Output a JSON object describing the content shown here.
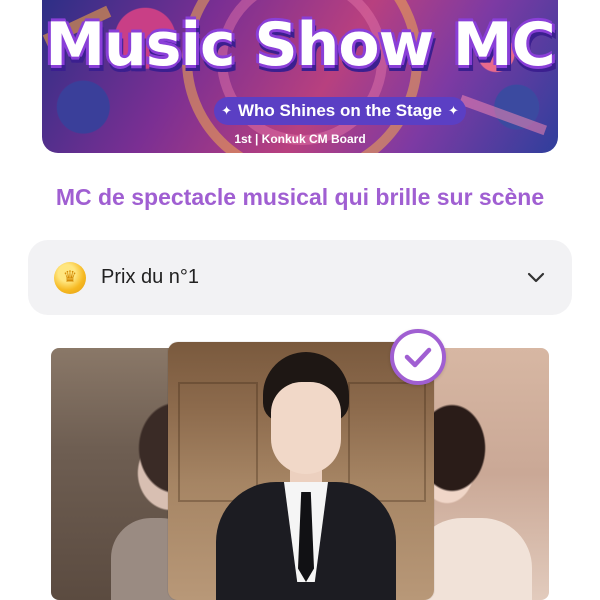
{
  "banner": {
    "title": "Music Show MC",
    "subtitle": "Who Shines on the Stage",
    "caption": "1st | Konkuk CM Board",
    "colors": {
      "title_outline": "#8a3fd8",
      "pill": "#5b3fc4"
    }
  },
  "headline": "MC de spectacle musical qui brille sur scène",
  "prize_dropdown": {
    "label": "Prix du n°1",
    "icon": "gold-crown-coin-icon",
    "expand_icon": "chevron-down-icon"
  },
  "candidates": [
    {
      "position": "left",
      "photo": "candidate-photo"
    },
    {
      "position": "center",
      "photo": "candidate-photo",
      "selected": true
    },
    {
      "position": "right",
      "photo": "candidate-photo"
    }
  ],
  "selection_badge_icon": "check-circle-icon",
  "colors": {
    "accent": "#a05fd2",
    "dropdown_bg": "#f2f2f4",
    "text": "#222222"
  }
}
